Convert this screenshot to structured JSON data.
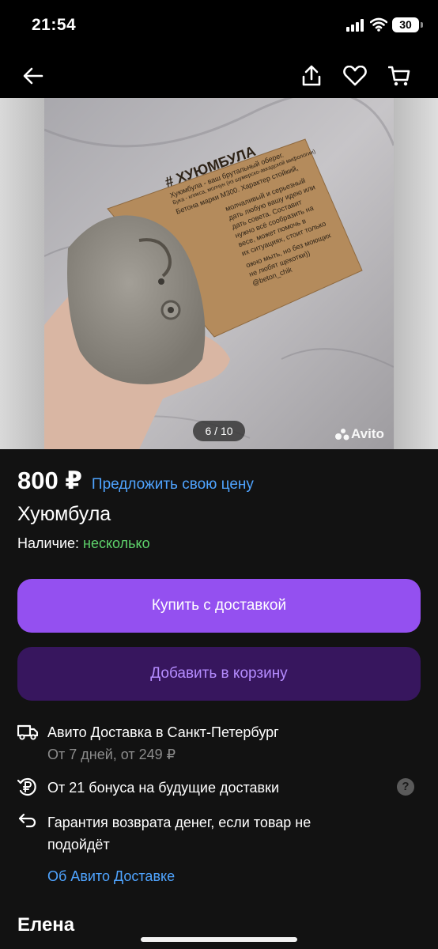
{
  "status_bar": {
    "time": "21:54",
    "battery": "30"
  },
  "nav": {
    "back_icon": "arrow-left-icon",
    "share_icon": "share-icon",
    "favorite_icon": "heart-icon",
    "cart_icon": "cart-icon"
  },
  "gallery": {
    "counter": "6 / 10",
    "watermark": "Avito",
    "card_heading": "# ХУЮМБУЛА",
    "card_lines": [
      "Хуюмбула - ваш брутальный оберег.",
      "Бука - клякса, молчун (из шумерско-аккадской мифологии)",
      "Бетона марки М300. Характер стойкий,",
      "молчаливый и серьезный",
      "дать любую вашу идею или",
      "дать совета. Составит",
      "нужно всё сообразить на",
      "весе, может помочь в",
      "их ситуациях, стоит только",
      "ожно мыть, но без моющих",
      "не любят щекотки))",
      "@beton_chik"
    ]
  },
  "listing": {
    "price": "800 ₽",
    "offer_link": "Предложить свою цену",
    "title": "Хуюмбула",
    "availability_label": "Наличие: ",
    "availability_value": "несколько"
  },
  "buttons": {
    "buy": "Купить с доставкой",
    "add_to_cart": "Добавить в корзину"
  },
  "delivery": {
    "title": "Авито Доставка в Санкт-Петербург",
    "subtitle": "От 7 дней, от 249 ₽",
    "bonus": "От 21 бонуса на будущие доставки",
    "help": "?",
    "guarantee": "Гарантия возврата денег, если товар не подойдёт",
    "about_link": "Об Авито Доставке"
  },
  "seller": {
    "name": "Елена"
  },
  "colors": {
    "accent": "#9450f0",
    "accent_dark": "#37165e",
    "link": "#4fa4ff",
    "available": "#5ed26b",
    "background": "#121212"
  }
}
